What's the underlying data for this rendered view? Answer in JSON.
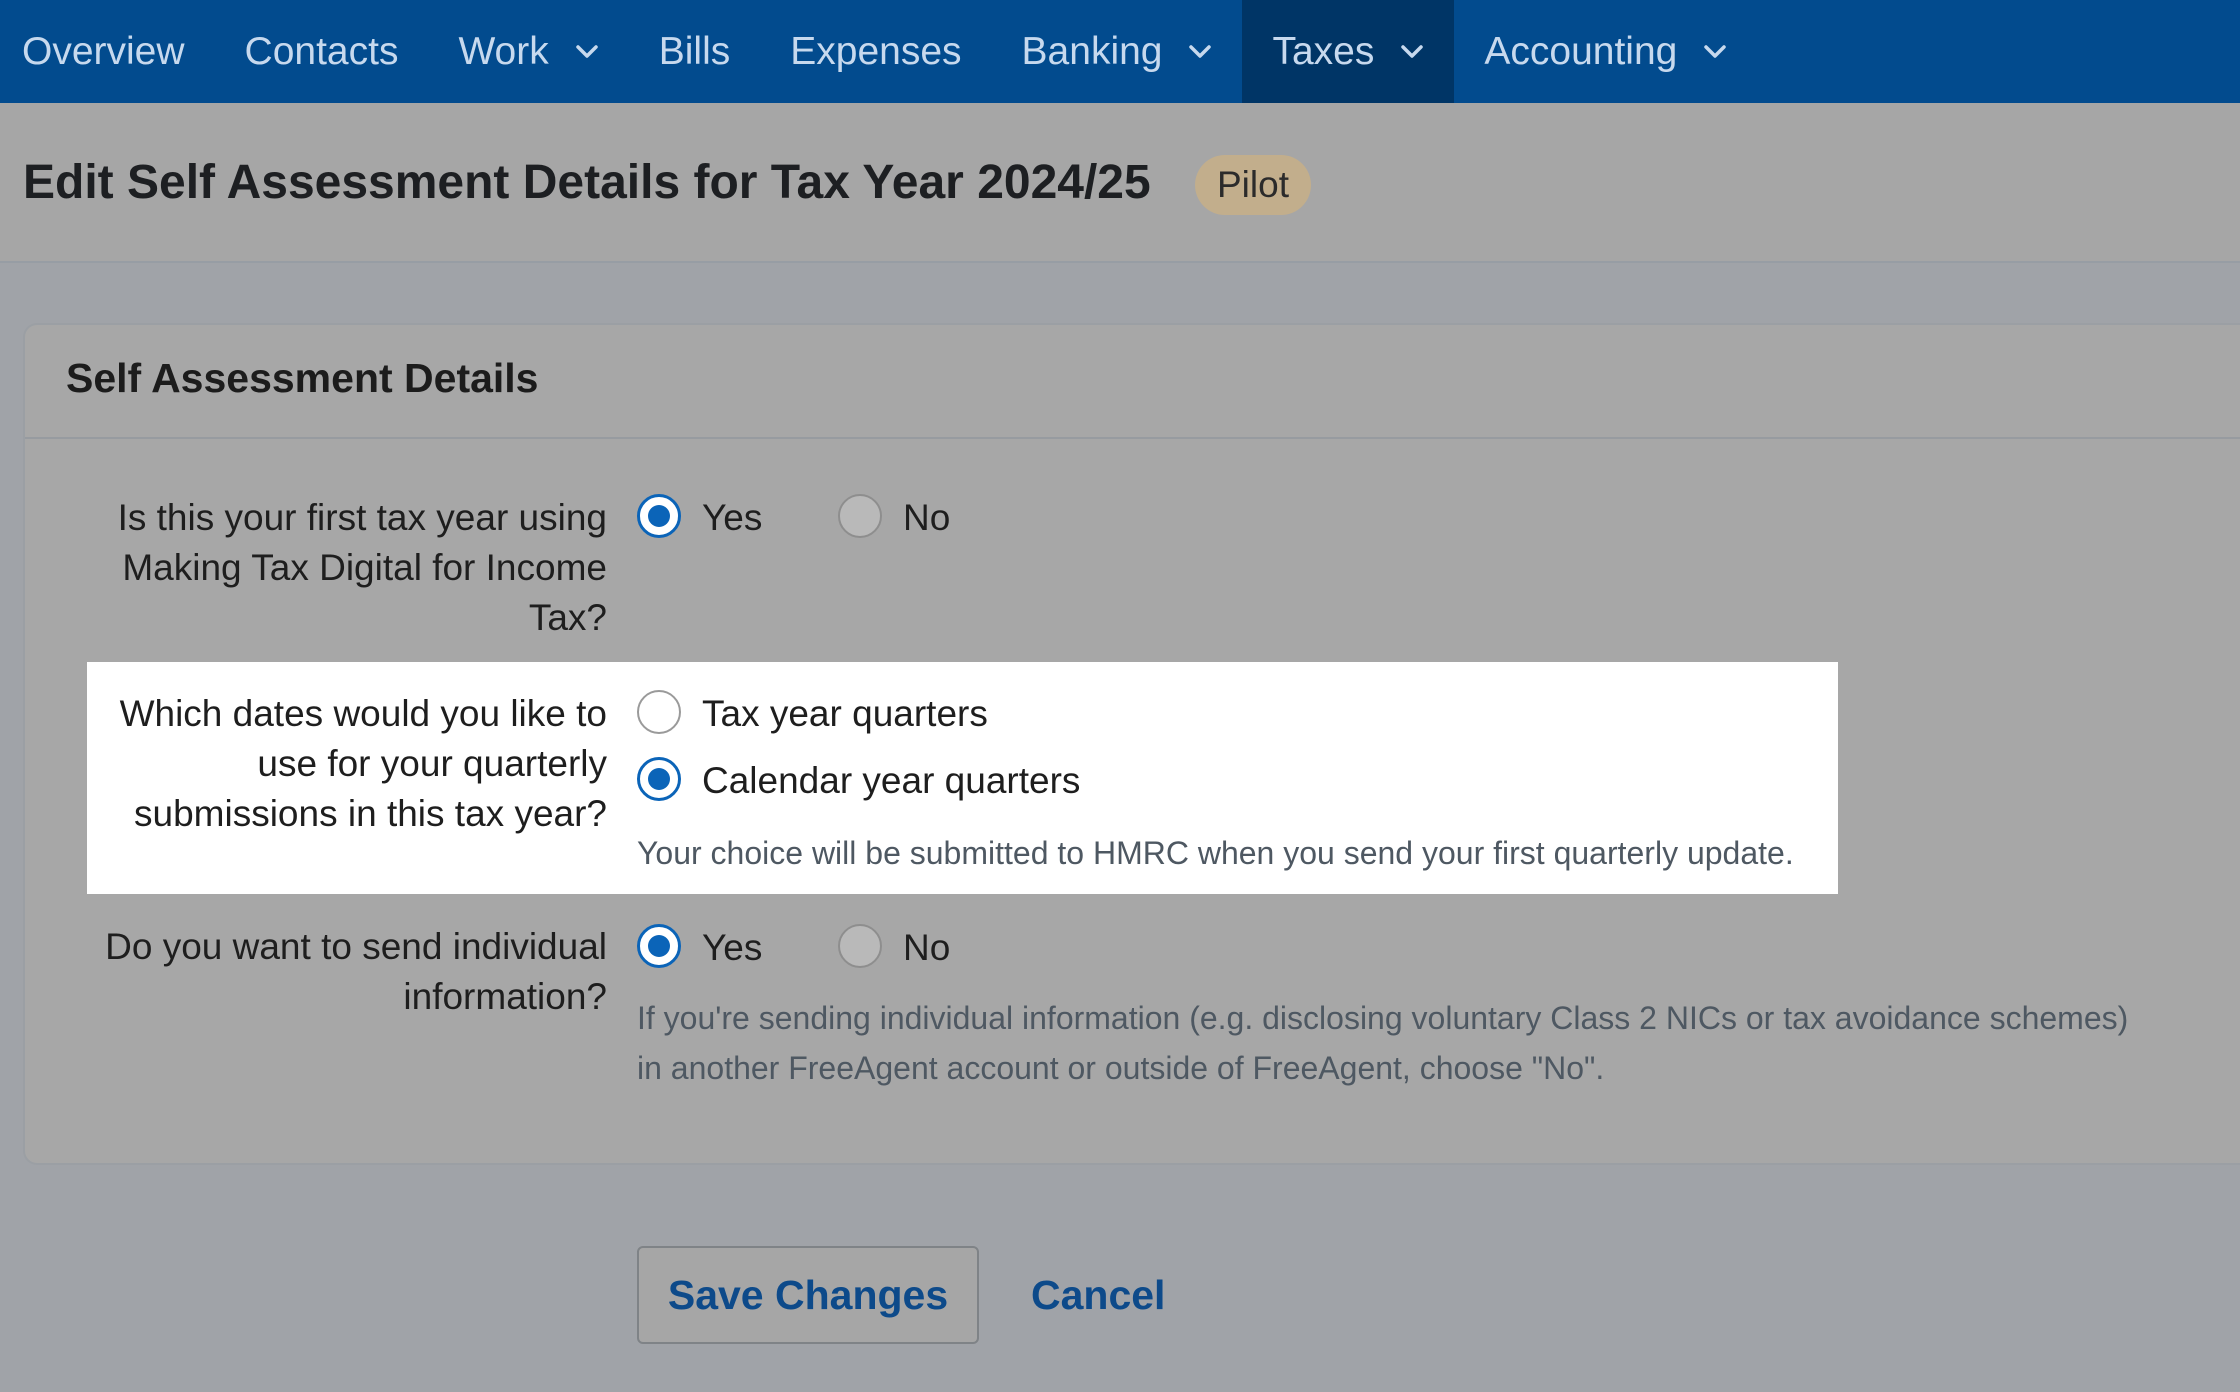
{
  "nav": {
    "items": [
      {
        "label": "Overview",
        "dropdown": false,
        "active": false
      },
      {
        "label": "Contacts",
        "dropdown": false,
        "active": false
      },
      {
        "label": "Work",
        "dropdown": true,
        "active": false
      },
      {
        "label": "Bills",
        "dropdown": false,
        "active": false
      },
      {
        "label": "Expenses",
        "dropdown": false,
        "active": false
      },
      {
        "label": "Banking",
        "dropdown": true,
        "active": false
      },
      {
        "label": "Taxes",
        "dropdown": true,
        "active": true
      },
      {
        "label": "Accounting",
        "dropdown": true,
        "active": false
      }
    ]
  },
  "header": {
    "title": "Edit Self Assessment Details for Tax Year 2024/25",
    "badge": "Pilot"
  },
  "card": {
    "title": "Self Assessment Details",
    "questions": [
      {
        "label_lines": [
          "Is this your first tax year using",
          "Making Tax Digital for Income",
          "Tax?"
        ],
        "options": [
          {
            "label": "Yes",
            "checked": true
          },
          {
            "label": "No",
            "checked": false
          }
        ]
      },
      {
        "label_lines": [
          "Which dates would you like to",
          "use for your quarterly",
          "submissions in this tax year?"
        ],
        "options": [
          {
            "label": "Tax year quarters",
            "checked": false
          },
          {
            "label": "Calendar year quarters",
            "checked": true
          }
        ],
        "hint": "Your choice will be submitted to HMRC when you send your first quarterly update."
      },
      {
        "label_lines": [
          "Do you want to send individual",
          "information?"
        ],
        "options": [
          {
            "label": "Yes",
            "checked": true
          },
          {
            "label": "No",
            "checked": false
          }
        ],
        "hint_lines": [
          "If you're sending individual information (e.g. disclosing voluntary Class 2 NICs or tax avoidance schemes)",
          "in another FreeAgent account or outside of FreeAgent, choose \"No\"."
        ]
      }
    ]
  },
  "actions": {
    "save_label": "Save Changes",
    "cancel_label": "Cancel"
  },
  "colors": {
    "nav_bg": "#024b8e",
    "nav_active_bg": "#003566",
    "radio_accent": "#0b64b8",
    "link": "#0d4a8a",
    "badge_bg": "#c2ae8c"
  }
}
